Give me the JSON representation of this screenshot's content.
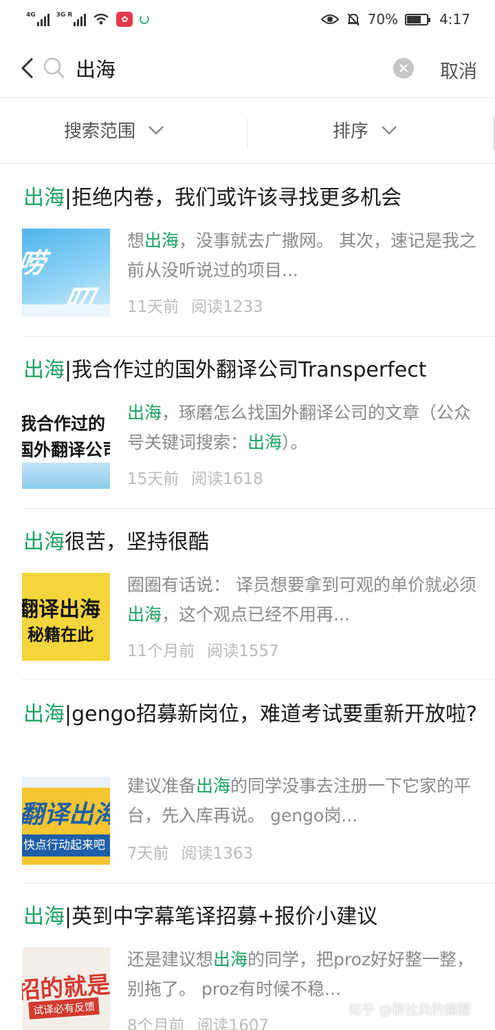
{
  "status_bar": {
    "signal1_label": "4G",
    "signal2_label": "3G R",
    "battery_text": "70%",
    "time": "4:17",
    "battery_level": 0.7
  },
  "search": {
    "query": "出海",
    "cancel_label": "取消"
  },
  "filters": {
    "scope_label": "搜索范围",
    "sort_label": "排序"
  },
  "colors": {
    "highlight": "#1aa260",
    "meta": "#bbbbbb",
    "summary": "#8a8a8a"
  },
  "results": [
    {
      "title_hl": "出海",
      "title_rest": "|拒绝内卷，我们或许该寻找更多机会",
      "summary": [
        {
          "t": "想",
          "h": false
        },
        {
          "t": "出海",
          "h": true
        },
        {
          "t": "，没事就去广撒网。 其次，速记是我之前从没听说过的项目...",
          "h": false
        }
      ],
      "time": "11天前",
      "reads": "阅读1233",
      "thumb_text": [
        "唠",
        "叨"
      ]
    },
    {
      "title_hl": "出海",
      "title_rest": "|我合作过的国外翻译公司Transperfect",
      "summary": [
        {
          "t": "出海",
          "h": true
        },
        {
          "t": "，琢磨怎么找国外翻译公司的文章（公众号关键词搜索：",
          "h": false
        },
        {
          "t": "出海",
          "h": true
        },
        {
          "t": "）。",
          "h": false
        }
      ],
      "time": "15天前",
      "reads": "阅读1618",
      "thumb_text": [
        "我合作过的",
        "国外翻译公司"
      ]
    },
    {
      "title_hl": "出海",
      "title_rest": "很苦，坚持很酷",
      "summary": [
        {
          "t": "圈圈有话说： 译员想要拿到可观的单价就必须",
          "h": false
        },
        {
          "t": "出海",
          "h": true
        },
        {
          "t": "，这个观点已经不用再...",
          "h": false
        }
      ],
      "time": "11个月前",
      "reads": "阅读1557",
      "thumb_text": [
        "翻译出海",
        "秘籍在此"
      ]
    },
    {
      "title_hl": "出海",
      "title_rest": "|gengo招募新岗位，难道考试要重新开放啦?",
      "summary": [
        {
          "t": "建议准备",
          "h": false
        },
        {
          "t": "出海",
          "h": true
        },
        {
          "t": "的同学没事去注册一下它家的平台，先入库再说。 gengo岗...",
          "h": false
        }
      ],
      "time": "7天前",
      "reads": "阅读1363",
      "thumb_text": [
        "翻译出海",
        "快点行动起来吧"
      ]
    },
    {
      "title_hl": "出海",
      "title_rest": "|英到中字幕笔译招募+报价小建议",
      "summary": [
        {
          "t": "还是建议想",
          "h": false
        },
        {
          "t": "出海",
          "h": true
        },
        {
          "t": "的同学，把proz好好整一整，别拖了。 proz有时候不稳...",
          "h": false
        }
      ],
      "time": "8个月前",
      "reads": "阅读1607",
      "thumb_text": [
        "招的就是你",
        "试译必有反馈"
      ]
    }
  ],
  "watermark": "知乎 @很拉风的圈圈",
  "icons": [
    "back-arrow-icon",
    "search-icon",
    "clear-icon",
    "chevron-down-icon",
    "eye-icon",
    "mute-bell-icon",
    "battery-icon",
    "wifi-icon",
    "signal-icon"
  ]
}
